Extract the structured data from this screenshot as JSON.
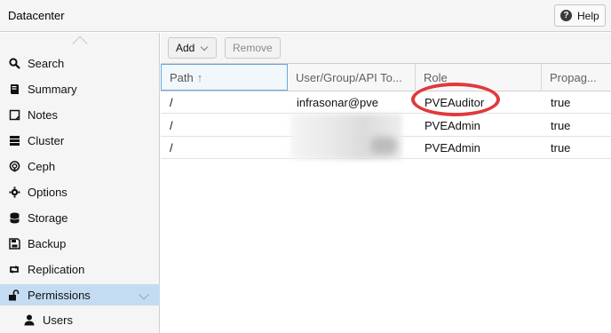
{
  "header": {
    "title": "Datacenter",
    "help_label": "Help"
  },
  "sidebar": {
    "items": [
      {
        "label": "Search",
        "icon": "search-icon"
      },
      {
        "label": "Summary",
        "icon": "book-icon"
      },
      {
        "label": "Notes",
        "icon": "notes-icon"
      },
      {
        "label": "Cluster",
        "icon": "server-icon"
      },
      {
        "label": "Ceph",
        "icon": "ceph-icon"
      },
      {
        "label": "Options",
        "icon": "gear-icon"
      },
      {
        "label": "Storage",
        "icon": "database-icon"
      },
      {
        "label": "Backup",
        "icon": "floppy-icon"
      },
      {
        "label": "Replication",
        "icon": "retweet-icon"
      },
      {
        "label": "Permissions",
        "icon": "unlock-icon"
      },
      {
        "label": "Users",
        "icon": "user-icon"
      }
    ],
    "active": "Permissions"
  },
  "toolbar": {
    "add_label": "Add",
    "remove_label": "Remove"
  },
  "grid": {
    "columns": [
      "Path",
      "User/Group/API To...",
      "Role",
      "Propag..."
    ],
    "sorted_column": "Path",
    "rows": [
      {
        "path": "/",
        "user": "infrasonar@pve",
        "role": "PVEAuditor",
        "propagate": "true"
      },
      {
        "path": "/",
        "user": "",
        "role": "PVEAdmin",
        "propagate": "true"
      },
      {
        "path": "/",
        "user": "",
        "role": "PVEAdmin",
        "propagate": "true"
      }
    ]
  },
  "colors": {
    "accent": "#c3dcf2",
    "highlight": "#e0393e"
  }
}
